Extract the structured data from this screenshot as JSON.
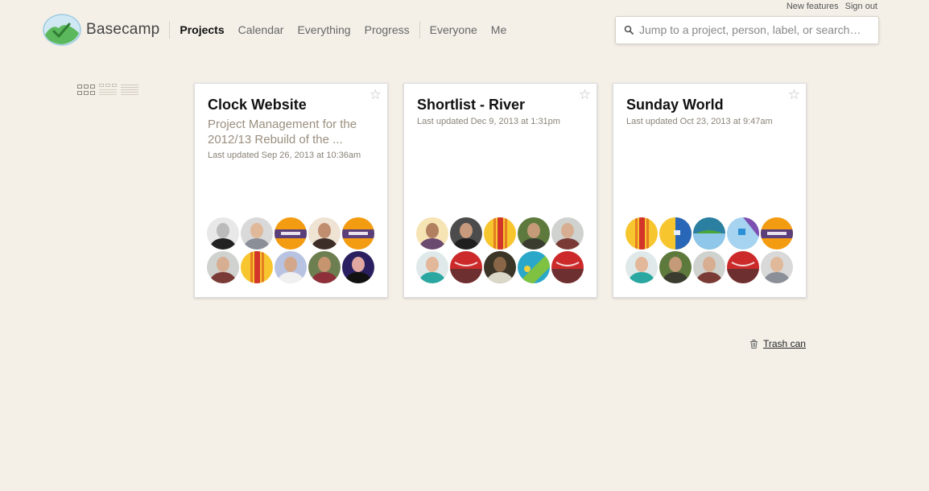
{
  "topbar": {
    "new_features": "New features",
    "sign_out": "Sign out"
  },
  "brand": {
    "name": "Basecamp",
    "logo_icon": "basecamp-hill-icon"
  },
  "nav": {
    "items": [
      {
        "label": "Projects",
        "active": true
      },
      {
        "label": "Calendar"
      },
      {
        "label": "Everything"
      },
      {
        "label": "Progress"
      },
      {
        "label": "Everyone"
      },
      {
        "label": "Me"
      }
    ]
  },
  "search": {
    "placeholder": "Jump to a project, person, label, or search…",
    "icon": "search-icon"
  },
  "view_toggles": [
    {
      "icon": "card-view-icon",
      "selected": true
    },
    {
      "icon": "compact-view-icon",
      "selected": false
    },
    {
      "icon": "list-view-icon",
      "selected": false
    }
  ],
  "projects": [
    {
      "title": "Clock Website",
      "description": "Project Management for the 2012/13 Rebuild of the ...",
      "updated": "Last updated Sep 26, 2013 at 10:36am",
      "avatars": [
        "photo-bw",
        "photo-light",
        "default-orange",
        "photo-beard",
        "default-orange",
        "photo-plaid",
        "default-yellow-red",
        "photo-blue",
        "photo-smile",
        "photo-glasses"
      ]
    },
    {
      "title": "Shortlist - River",
      "description": "",
      "updated": "Last updated Dec 9, 2013 at 1:31pm",
      "avatars": [
        "photo-sun",
        "photo-dark",
        "default-yellow-red",
        "photo-outdoor",
        "photo-plaid",
        "photo-teal",
        "default-red",
        "photo-curly",
        "default-green-blue",
        "default-red"
      ]
    },
    {
      "title": "Sunday World",
      "description": "",
      "updated": "Last updated Oct 23, 2013 at 9:47am",
      "avatars": [
        "default-yellow-red",
        "default-yellow-blue",
        "default-teal-green",
        "default-sky-purple",
        "default-orange",
        "photo-teal",
        "photo-outdoor",
        "photo-plaid",
        "default-red",
        "photo-light"
      ]
    }
  ],
  "trash": {
    "label": "Trash can",
    "icon": "trash-icon"
  },
  "colors": {
    "background": "#f4f0e8",
    "description_text": "#9a8f7f",
    "avatar_orange": "#f39c12",
    "avatar_yellow": "#f7c62f",
    "avatar_red": "#cc2a2a",
    "avatar_teal": "#2aa7c9"
  }
}
